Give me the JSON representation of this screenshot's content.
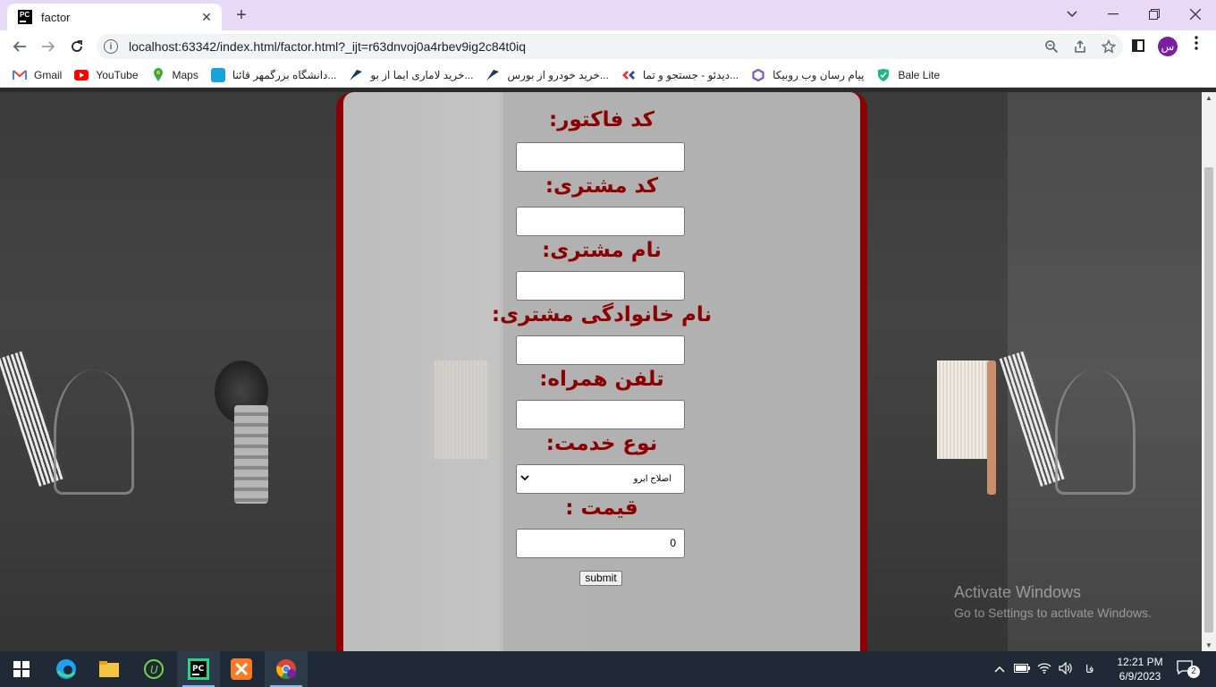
{
  "browser": {
    "tab_title": "factor",
    "tab_close": "✕",
    "new_tab": "+",
    "url": "localhost:63342/index.html/factor.html?_ijt=r63dnvoj0a4rbev9ig2c84t0iq",
    "profile_initial": "س"
  },
  "bookmarks": [
    {
      "label": "Gmail",
      "icon": "gmail-icon",
      "color": "#ea4335"
    },
    {
      "label": "YouTube",
      "icon": "youtube-icon",
      "color": "#ff0000"
    },
    {
      "label": "Maps",
      "icon": "maps-icon",
      "color": "#34a853"
    },
    {
      "label": "دانشگاه بزرگمهر قائنا...",
      "icon": "university-icon",
      "color": "#1aa3d9"
    },
    {
      "label": "خرید لاماری ایما از بو...",
      "icon": "bourse-icon",
      "color": "#1a3a5a"
    },
    {
      "label": "خرید خودرو از بورس...",
      "icon": "bourse-icon",
      "color": "#1a3a5a"
    },
    {
      "label": "دیدئو - جستجو و تما...",
      "icon": "video-icon",
      "color": "#e53935"
    },
    {
      "label": "پیام رسان وب روبیکا",
      "icon": "rubika-icon",
      "color": "#7e57c2"
    },
    {
      "label": "Bale Lite",
      "icon": "bale-icon",
      "color": "#1eb980"
    }
  ],
  "form": {
    "invoice_code_label": "کد فاکتور:",
    "customer_code_label": "کد مشتری:",
    "customer_name_label": "نام مشتری:",
    "customer_family_label": "نام خانوادگی مشتری:",
    "mobile_label": "تلفن همراه:",
    "service_type_label": "نوع خدمت:",
    "service_selected": "اصلاح ابرو",
    "price_label": "قیمت :",
    "price_value": "0",
    "submit_label": "submit"
  },
  "watermark": {
    "line1": "Activate Windows",
    "line2": "Go to Settings to activate Windows."
  },
  "taskbar": {
    "language": "فا",
    "time": "12:21 PM",
    "date": "6/9/2023",
    "notification_count": "2"
  },
  "colors": {
    "label_color": "#8b0000",
    "panel_border": "#8b0000",
    "tab_bar": "#e8d9f7"
  }
}
